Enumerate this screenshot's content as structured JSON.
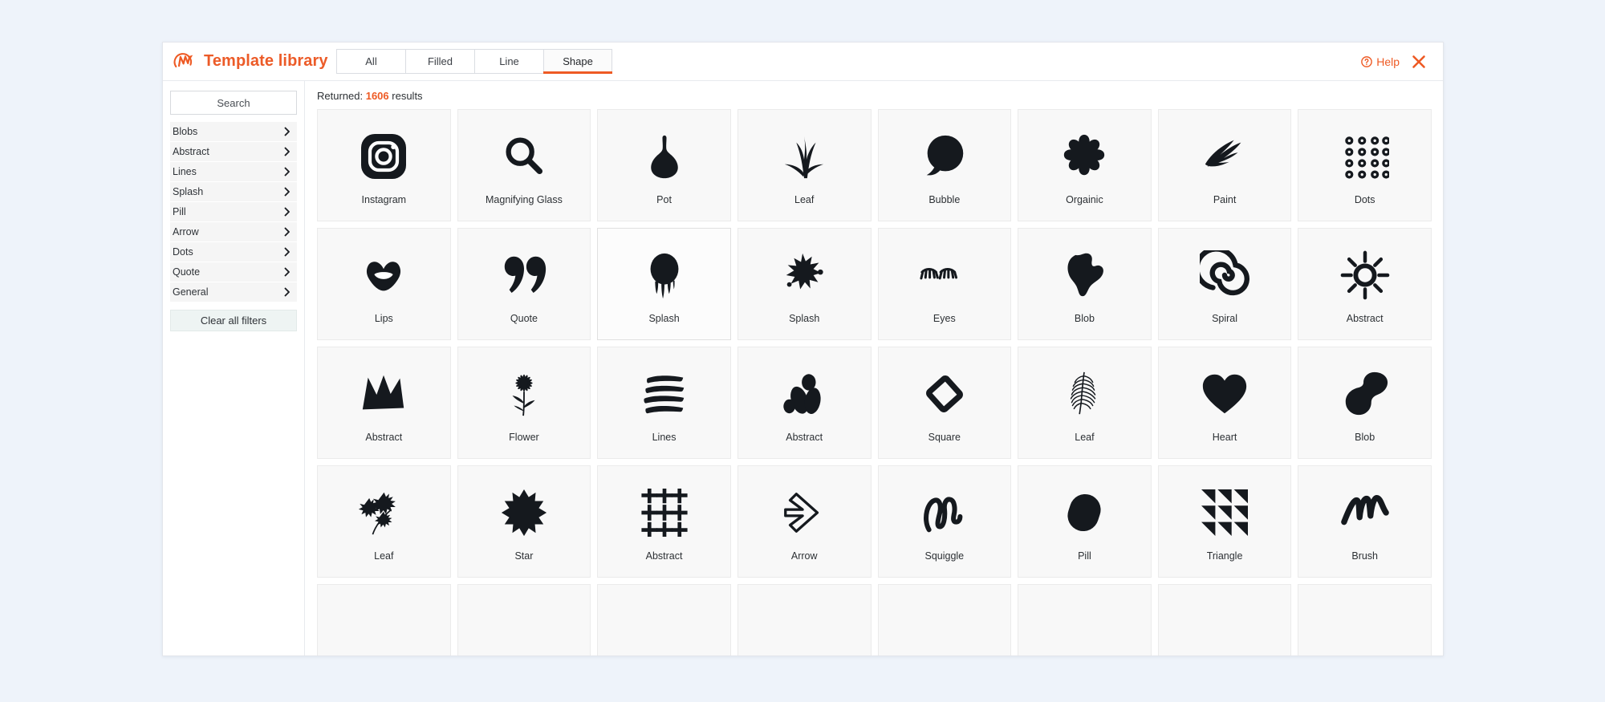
{
  "app": {
    "brand_title": "Template library",
    "logo_icon": "brand-m-logo-icon",
    "accent_color": "#ee5a24",
    "page_background": "#eef3fa"
  },
  "header": {
    "tabs": [
      {
        "label": "All",
        "active": false
      },
      {
        "label": "Filled",
        "active": false
      },
      {
        "label": "Line",
        "active": false
      },
      {
        "label": "Shape",
        "active": true
      }
    ],
    "help_label": "Help",
    "help_icon": "question-circle-icon",
    "close_icon": "close-x-icon"
  },
  "sidebar": {
    "search": {
      "value": "",
      "placeholder": "Search",
      "icon": "search-input"
    },
    "filters": [
      {
        "label": "Blobs",
        "chevron": "chevron-right-icon"
      },
      {
        "label": "Abstract",
        "chevron": "chevron-right-icon"
      },
      {
        "label": "Lines",
        "chevron": "chevron-right-icon"
      },
      {
        "label": "Splash",
        "chevron": "chevron-right-icon"
      },
      {
        "label": "Pill",
        "chevron": "chevron-right-icon"
      },
      {
        "label": "Arrow",
        "chevron": "chevron-right-icon"
      },
      {
        "label": "Dots",
        "chevron": "chevron-right-icon"
      },
      {
        "label": "Quote",
        "chevron": "chevron-right-icon"
      },
      {
        "label": "General",
        "chevron": "chevron-right-icon"
      }
    ],
    "clear_filters_label": "Clear all filters"
  },
  "main": {
    "results_prefix": "Returned:",
    "results_count": "1606",
    "results_suffix": "results",
    "items": [
      {
        "label": "Instagram",
        "icon": "instagram-shape-icon"
      },
      {
        "label": "Magnifying Glass",
        "icon": "magnifying-glass-shape-icon"
      },
      {
        "label": "Pot",
        "icon": "pot-shape-icon"
      },
      {
        "label": "Leaf",
        "icon": "leaf-blades-shape-icon"
      },
      {
        "label": "Bubble",
        "icon": "speech-bubble-shape-icon"
      },
      {
        "label": "Orgainic",
        "icon": "organic-blob-shape-icon"
      },
      {
        "label": "Paint",
        "icon": "paint-stroke-shape-icon"
      },
      {
        "label": "Dots",
        "icon": "dots-ring-grid-shape-icon"
      },
      {
        "label": "Lips",
        "icon": "lips-shape-icon"
      },
      {
        "label": "Quote",
        "icon": "quote-marks-shape-icon"
      },
      {
        "label": "Splash",
        "icon": "drip-splash-shape-icon",
        "hovered": true
      },
      {
        "label": "Splash",
        "icon": "splat-splash-shape-icon"
      },
      {
        "label": "Eyes",
        "icon": "eyes-lashes-shape-icon"
      },
      {
        "label": "Blob",
        "icon": "blob-shape-icon"
      },
      {
        "label": "Spiral",
        "icon": "spiral-shape-icon"
      },
      {
        "label": "Abstract",
        "icon": "sun-burst-shape-icon"
      },
      {
        "label": "Abstract",
        "icon": "crown-shape-icon"
      },
      {
        "label": "Flower",
        "icon": "flower-shape-icon"
      },
      {
        "label": "Lines",
        "icon": "brush-lines-shape-icon"
      },
      {
        "label": "Abstract",
        "icon": "pebble-cluster-shape-icon"
      },
      {
        "label": "Square",
        "icon": "rotated-square-outline-shape-icon"
      },
      {
        "label": "Leaf",
        "icon": "fern-leaf-shape-icon"
      },
      {
        "label": "Heart",
        "icon": "heart-shape-icon"
      },
      {
        "label": "Blob",
        "icon": "bone-blob-shape-icon"
      },
      {
        "label": "Leaf",
        "icon": "maple-branch-shape-icon"
      },
      {
        "label": "Star",
        "icon": "star-burst-shape-icon"
      },
      {
        "label": "Abstract",
        "icon": "plus-grid-shape-icon"
      },
      {
        "label": "Arrow",
        "icon": "arrow-outline-shape-icon"
      },
      {
        "label": "Squiggle",
        "icon": "squiggle-shape-icon"
      },
      {
        "label": "Pill",
        "icon": "pill-shape-icon"
      },
      {
        "label": "Triangle",
        "icon": "triangle-grid-shape-icon"
      },
      {
        "label": "Brush",
        "icon": "brush-zigzag-shape-icon"
      }
    ],
    "placeholder_row_count": 8
  }
}
